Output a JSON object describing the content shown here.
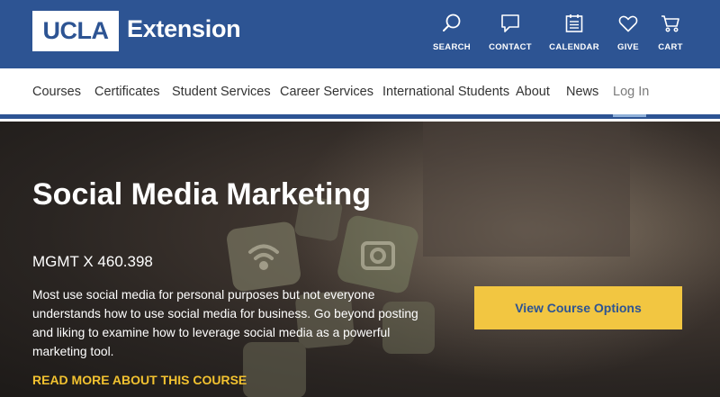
{
  "header": {
    "logo_text": "UCLA",
    "brand_text": "Extension",
    "utility_nav": [
      {
        "label": "SEARCH",
        "icon": "search-icon"
      },
      {
        "label": "CONTACT",
        "icon": "chat-icon"
      },
      {
        "label": "CALENDAR",
        "icon": "calendar-icon"
      },
      {
        "label": "GIVE",
        "icon": "heart-icon"
      },
      {
        "label": "CART",
        "icon": "cart-icon"
      }
    ]
  },
  "nav": {
    "items": [
      {
        "label": "Courses"
      },
      {
        "label": "Certificates"
      },
      {
        "label": "Student Services"
      },
      {
        "label": "Career Services"
      },
      {
        "label": "International Students"
      },
      {
        "label": "About"
      },
      {
        "label": "News"
      },
      {
        "label": "Log In"
      }
    ]
  },
  "hero": {
    "title": "Social Media Marketing",
    "course_code": "MGMT X 460.398",
    "description": "Most use social media for personal purposes but not everyone understands how to use social media for business. Go beyond posting and liking to examine how to leverage social media as a powerful marketing tool.",
    "read_more": "READ MORE ABOUT THIS COURSE",
    "cta_label": "View Course Options"
  },
  "colors": {
    "brand_blue": "#2d5493",
    "accent_gold": "#f2c641",
    "link_gold": "#f2c230"
  }
}
